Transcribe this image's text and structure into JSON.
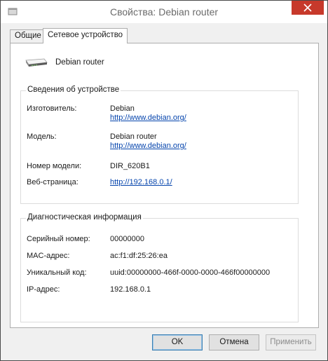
{
  "window": {
    "title": "Свойства: Debian router",
    "close_label": "✕"
  },
  "tabs": [
    {
      "label": "Общие"
    },
    {
      "label": "Сетевое устройство"
    }
  ],
  "device": {
    "name": "Debian router"
  },
  "device_info": {
    "title": "Сведения об устройстве",
    "manufacturer_label": "Изготовитель:",
    "manufacturer_name": "Debian",
    "manufacturer_url": "http://www.debian.org/",
    "model_label": "Модель:",
    "model_name": "Debian router",
    "model_url": "http://www.debian.org/",
    "model_number_label": "Номер модели:",
    "model_number": "DIR_620B1",
    "webpage_label": "Веб-страница:",
    "webpage_url": "http://192.168.0.1/"
  },
  "diagnostics": {
    "title": "Диагностическая информация",
    "serial_label": "Серийный номер:",
    "serial": "00000000",
    "mac_label": "MAC-адрес:",
    "mac": "ac:f1:df:25:26:ea",
    "uid_label": "Уникальный код:",
    "uid": "uuid:00000000-466f-0000-0000-466f00000000",
    "ip_label": "IP-адрес:",
    "ip": "192.168.0.1"
  },
  "buttons": {
    "ok": "OK",
    "cancel": "Отмена",
    "apply": "Применить"
  },
  "colors": {
    "close_button": "#c7392b",
    "link": "#0645ad"
  }
}
